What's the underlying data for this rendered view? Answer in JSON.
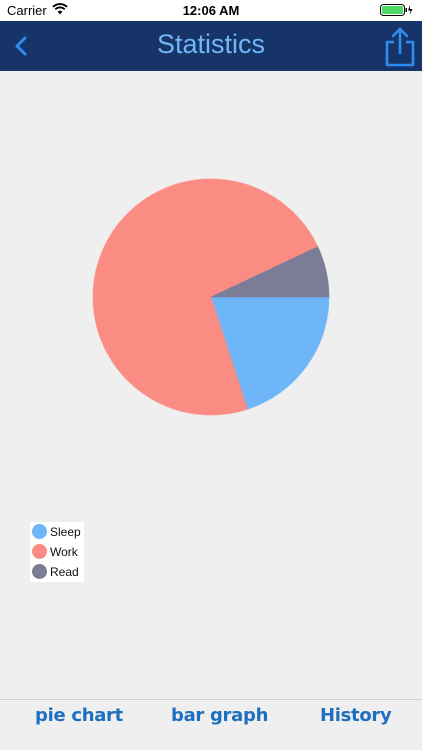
{
  "status_bar": {
    "carrier": "Carrier",
    "time": "12:06 AM"
  },
  "nav": {
    "title": "Statistics",
    "back_icon": "chevron-left-icon",
    "share_icon": "share-icon"
  },
  "chart_data": {
    "type": "pie",
    "title": "",
    "slices": [
      {
        "label": "Sleep",
        "value": 20,
        "color": "#6eb6f8"
      },
      {
        "label": "Work",
        "value": 73,
        "color": "#fb8c84"
      },
      {
        "label": "Read",
        "value": 7,
        "color": "#7b7d97"
      }
    ],
    "legend_position": "bottom-left"
  },
  "legend": {
    "items": [
      {
        "label": "Sleep",
        "color": "#6eb6f8"
      },
      {
        "label": "Work",
        "color": "#fb8c84"
      },
      {
        "label": "Read",
        "color": "#7b7d97"
      }
    ]
  },
  "tabs": [
    {
      "label": "pie chart"
    },
    {
      "label": "bar graph"
    },
    {
      "label": "History"
    }
  ],
  "colors": {
    "nav_bg": "#173468",
    "accent": "#6fb7f5",
    "tab_text": "#1e6fbf"
  }
}
